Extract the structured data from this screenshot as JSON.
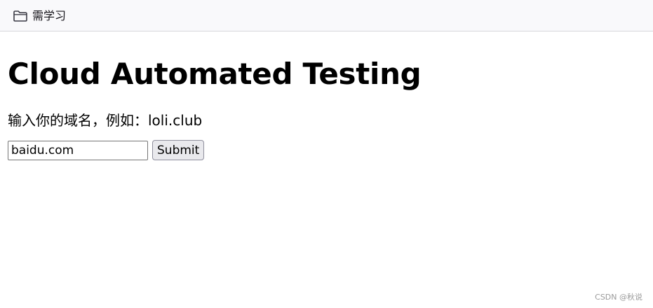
{
  "bookmarks_bar": {
    "items": [
      {
        "label": "需学习",
        "icon": "folder-icon"
      }
    ]
  },
  "main": {
    "title": "Cloud Automated Testing",
    "hint": "输入你的域名，例如：loli.club",
    "form": {
      "domain_value": "baidu.com",
      "submit_label": "Submit"
    }
  },
  "watermark": "CSDN @秋说",
  "colors": {
    "toolbar_bg": "#f9f9fb",
    "button_bg": "#e9e9ed",
    "watermark": "#9a9a9a"
  }
}
